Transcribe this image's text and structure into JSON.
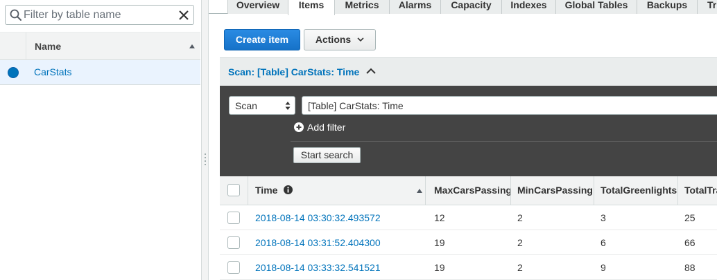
{
  "filter": {
    "placeholder": "Filter by table name",
    "value": ""
  },
  "tables_list": {
    "header": "Name",
    "rows": [
      {
        "name": "CarStats",
        "selected": true
      }
    ]
  },
  "tabs": [
    "Overview",
    "Items",
    "Metrics",
    "Alarms",
    "Capacity",
    "Indexes",
    "Global Tables",
    "Backups",
    "Tr"
  ],
  "active_tab": "Items",
  "toolbar": {
    "create_label": "Create item",
    "actions_label": "Actions"
  },
  "scan_panel": {
    "title": "Scan: [Table] CarStats: Time",
    "mode": "Scan",
    "target": "[Table] CarStats: Time",
    "add_filter": "Add filter",
    "start_search": "Start search"
  },
  "results": {
    "columns": [
      "Time",
      "MaxCarsPassing",
      "MinCarsPassing",
      "TotalGreenlights",
      "TotalTra"
    ],
    "rows": [
      [
        "2018-08-14 03:30:32.493572",
        "12",
        "2",
        "3",
        "25"
      ],
      [
        "2018-08-14 03:31:52.404300",
        "19",
        "2",
        "6",
        "66"
      ],
      [
        "2018-08-14 03:33:32.541521",
        "19",
        "2",
        "9",
        "88"
      ]
    ]
  },
  "colors": {
    "link": "#0073bb",
    "primary": "#1d7fd8",
    "dark_panel": "#444444",
    "selected_row": "#eaf3fe"
  }
}
